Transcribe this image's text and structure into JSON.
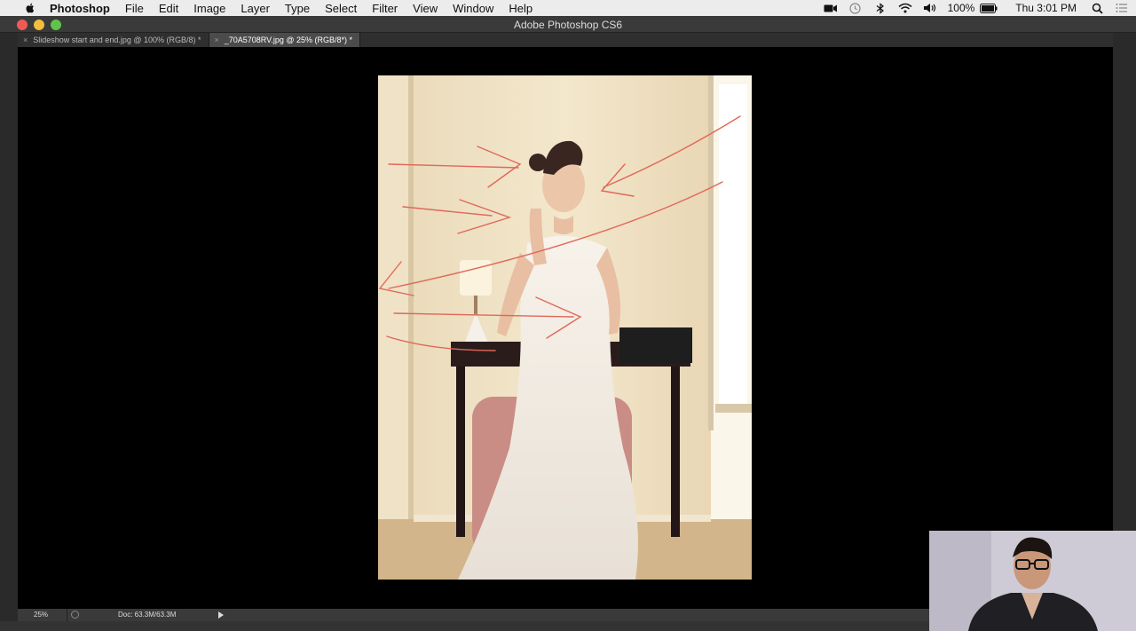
{
  "menubar": {
    "app_name": "Photoshop",
    "items": [
      "File",
      "Edit",
      "Image",
      "Layer",
      "Type",
      "Select",
      "Filter",
      "View",
      "Window",
      "Help"
    ],
    "battery": "100%",
    "clock": "Thu 3:01 PM"
  },
  "window": {
    "title": "Adobe Photoshop CS6"
  },
  "tabs": [
    {
      "label": "Slideshow start and end.jpg @ 100% (RGB/8) *"
    },
    {
      "label": "_70A5708RV.jpg @ 25% (RGB/8*) *"
    }
  ],
  "status": {
    "zoom": "25%",
    "doc": "Doc: 63.3M/63.3M"
  },
  "colors": {
    "menubar_bg": "#ececec",
    "canvas_bg": "#000000",
    "annotation_stroke": "#e0685a"
  },
  "icons": [
    "apple-icon",
    "facetime-icon",
    "time-machine-icon",
    "bluetooth-icon",
    "wifi-icon",
    "volume-icon",
    "battery-icon",
    "spotlight-icon",
    "notification-center-icon"
  ]
}
